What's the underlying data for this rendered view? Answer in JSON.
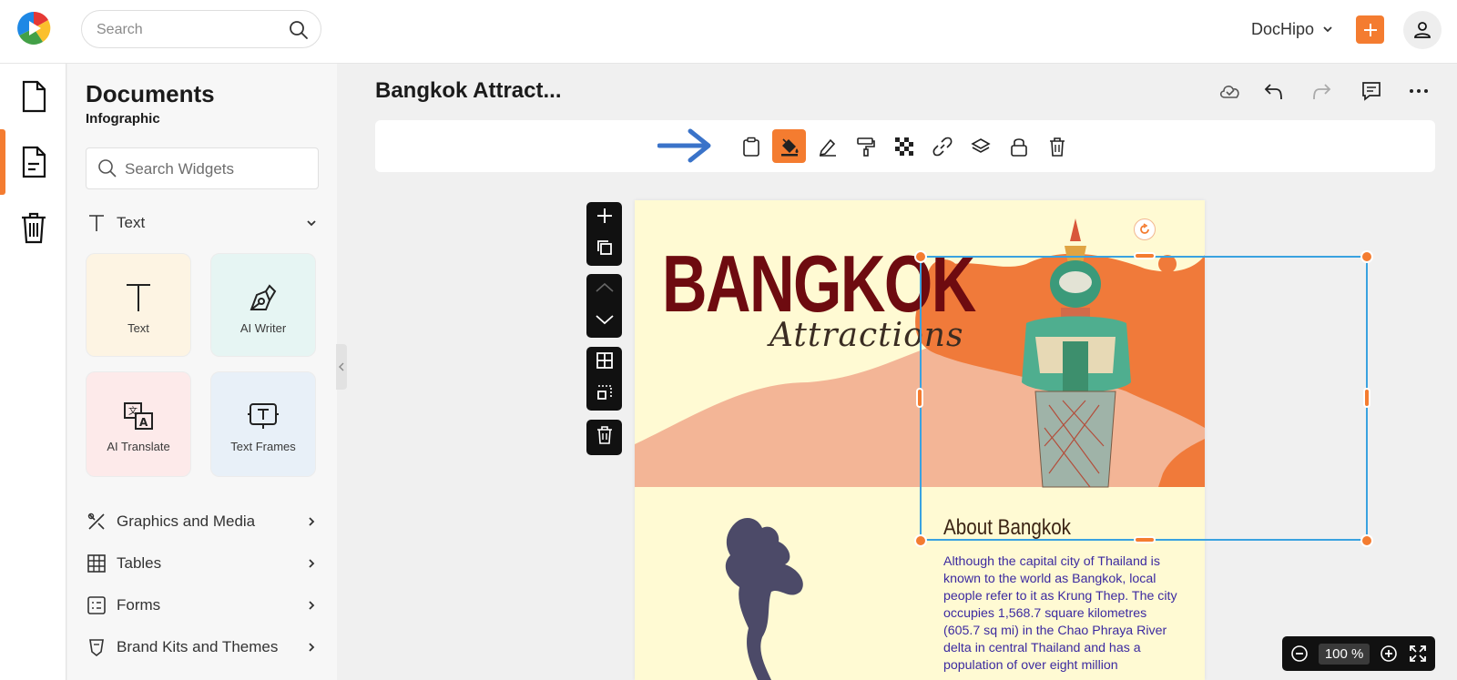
{
  "header": {
    "search_placeholder": "Search",
    "account_label": "DocHipo"
  },
  "sidebar": {
    "title": "Documents",
    "subtitle": "Infographic",
    "widget_search_placeholder": "Search Widgets",
    "text_section_label": "Text",
    "cards": [
      {
        "label": "Text"
      },
      {
        "label": "AI Writer"
      },
      {
        "label": "AI Translate"
      },
      {
        "label": "Text Frames"
      }
    ],
    "sections": [
      {
        "label": "Graphics and Media"
      },
      {
        "label": "Tables"
      },
      {
        "label": "Forms"
      },
      {
        "label": "Brand Kits and Themes"
      }
    ]
  },
  "editor": {
    "doc_title": "Bangkok Attract...",
    "zoom_level": "100 %"
  },
  "canvas": {
    "heading": "BANGKOK",
    "subheading": "Attractions",
    "about_title": "About Bangkok",
    "about_text": "Although the capital city of Thailand is known to the world as Bangkok, local people refer to it as Krung Thep. The city occupies 1,568.7 square kilometres (605.7 sq mi) in the Chao Phraya River delta in central Thailand and has a population of over eight million"
  },
  "colors": {
    "accent": "#f47c30",
    "selection": "#3aa2e0",
    "canvas_bg": "#fffad3",
    "heading": "#6e0b10",
    "body_text": "#3c2aa0"
  }
}
